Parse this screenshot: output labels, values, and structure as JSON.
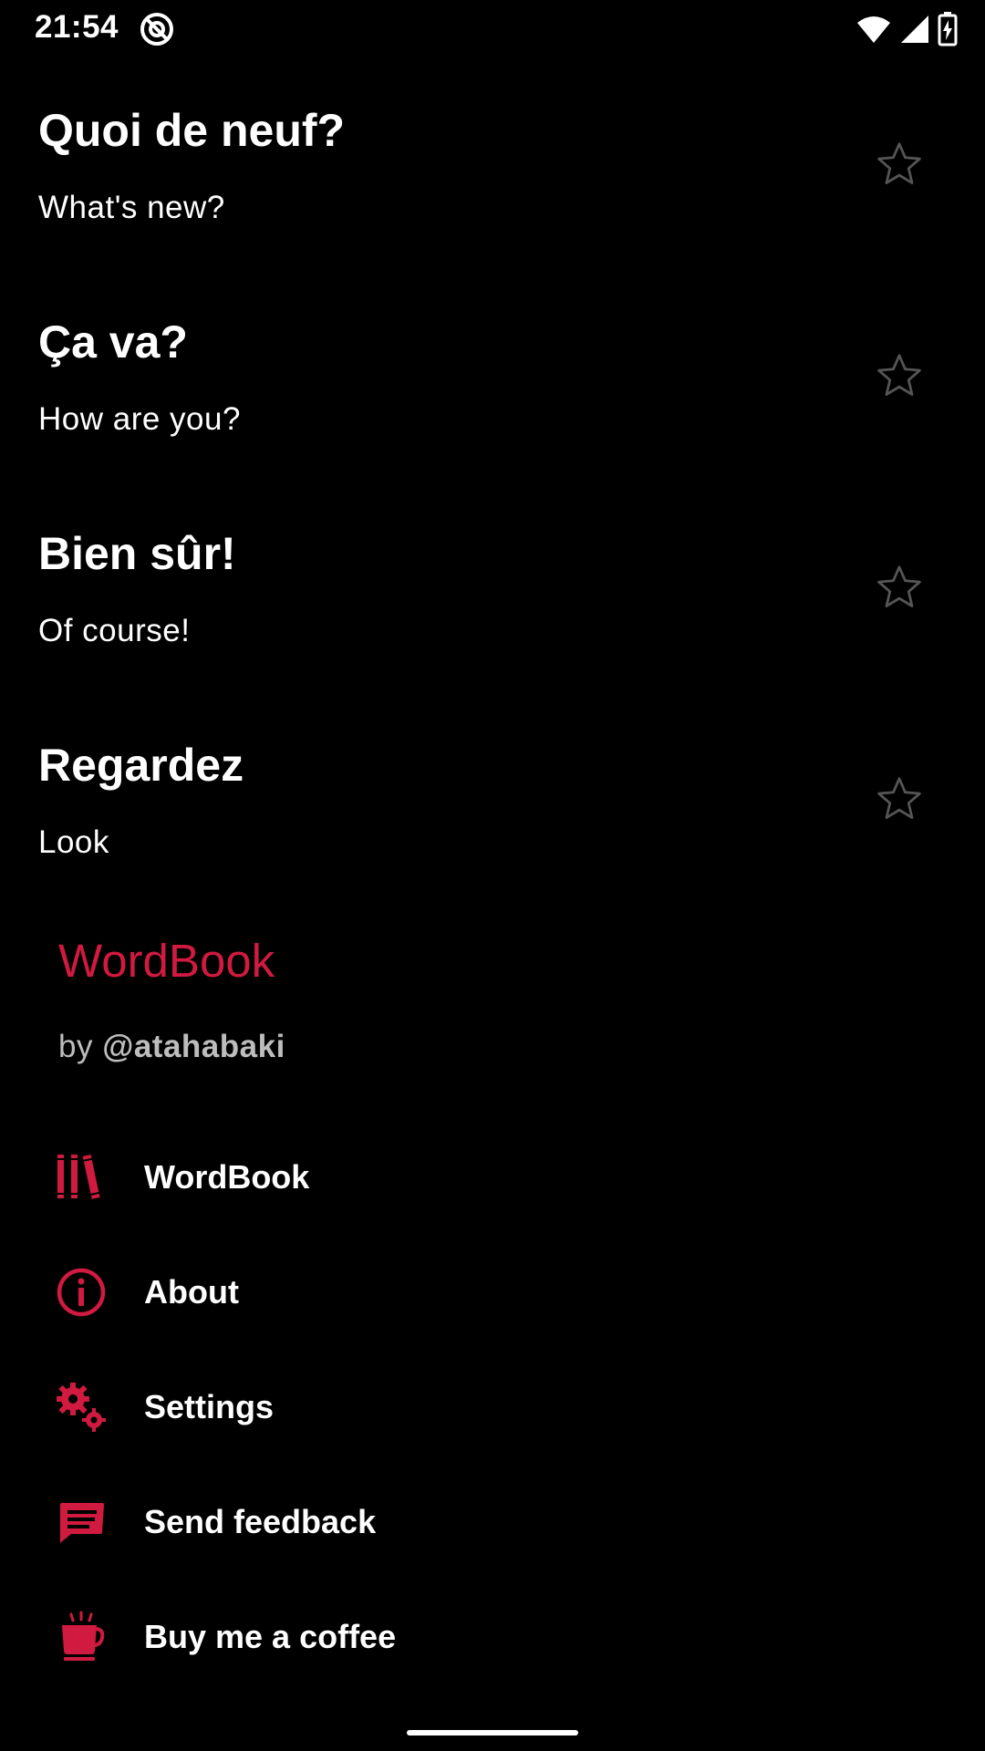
{
  "status_bar": {
    "time": "21:54"
  },
  "colors": {
    "accent": "#d01a3f",
    "background": "#000000",
    "text": "#ffffff",
    "muted_text": "#bdbdbd",
    "star_outline": "#555555"
  },
  "phrases": [
    {
      "french": "Quoi de neuf?",
      "english": "What's new?",
      "icon": "star-outline-icon"
    },
    {
      "french": "Ça va?",
      "english": "How are you?",
      "icon": "star-outline-icon"
    },
    {
      "french": "Bien sûr!",
      "english": "Of course!",
      "icon": "star-outline-icon"
    },
    {
      "french": "Regardez",
      "english": "Look",
      "icon": "star-outline-icon"
    }
  ],
  "drawer": {
    "app_name": "WordBook",
    "author_prefix": "by ",
    "author_handle": "@atahabaki",
    "menu": [
      {
        "label": "WordBook",
        "icon": "books-icon"
      },
      {
        "label": "About",
        "icon": "info-icon"
      },
      {
        "label": "Settings",
        "icon": "gears-icon"
      },
      {
        "label": "Send feedback",
        "icon": "message-icon"
      },
      {
        "label": "Buy me a coffee",
        "icon": "coffee-icon"
      }
    ]
  }
}
